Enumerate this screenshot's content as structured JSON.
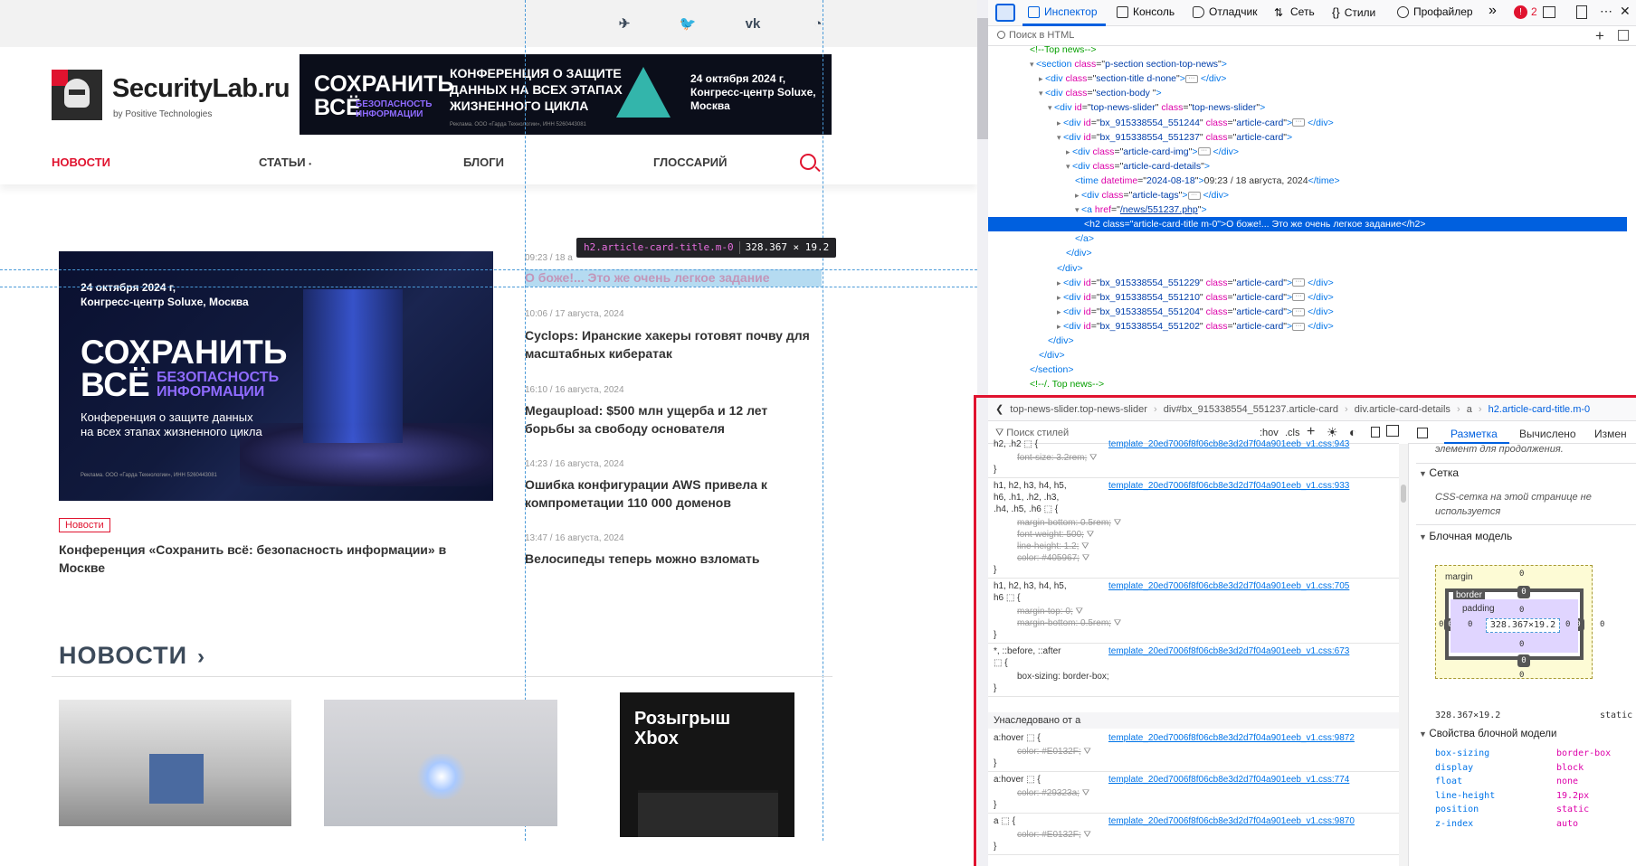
{
  "site": {
    "social_icons": [
      "telegram-icon",
      "twitter-icon",
      "vk-icon",
      "rss-icon"
    ],
    "social_glyphs": [
      "✈",
      "🐦",
      "vk",
      "◔"
    ],
    "logo": {
      "title": "SecurityLab.ru",
      "subtitle": "by Positive Technologies"
    },
    "top_banner": {
      "big": "СОХРАНИТЬ\nВСЁ",
      "sub": "БЕЗОПАСНОСТЬ\nИНФОРМАЦИИ",
      "headline": "КОНФЕРЕНЦИЯ О ЗАЩИТЕ ДАННЫХ НА ВСЕХ ЭТАПАХ ЖИЗНЕННОГО ЦИКЛА",
      "date": "24 октября 2024 г, Конгресс-центр Soluxe, Москва",
      "fine": "Реклама. ООО «Гарда Технологии», ИНН 5260443081"
    },
    "nav": {
      "news": "НОВОСТИ",
      "articles": "СТАТЬИ",
      "articles_dot": "•",
      "blogs": "БЛОГИ",
      "glossary": "ГЛОССАРИЙ"
    },
    "hero": {
      "date": "24 октября 2024 г,\nКонгресс-центр Soluxe, Москва",
      "big": "СОХРАНИТЬ\nВСЁ",
      "purple": "БЕЗОПАСНОСТЬ\nИНФОРМАЦИИ",
      "text": "Конференция о защите данных\nна всех этапах жизненного цикла",
      "fine": "Реклама. ООО «Гарда Технологии», ИНН 5260443081",
      "tag": "Новости",
      "title": "Конференция «Сохранить всё: безопасность информации» в Москве"
    },
    "news": [
      {
        "date": "09:23 / 18 а",
        "title": "О боже!... Это же очень легкое задание"
      },
      {
        "date": "10:06 / 17 августа, 2024",
        "title": "Cyclops: Иранские хакеры готовят почву для масштабных кибератак"
      },
      {
        "date": "16:10 / 16 августа, 2024",
        "title": "Megaupload: $500 млн ущерба и 12 лет борьбы за свободу основателя"
      },
      {
        "date": "14:23 / 16 августа, 2024",
        "title": "Ошибка конфигурации AWS привела к компрометации 110 000 доменов"
      },
      {
        "date": "13:47 / 16 августа, 2024",
        "title": "Велосипеды теперь можно взломать"
      }
    ],
    "tooltip": {
      "selector": "h2.article-card-title.m-0",
      "size": "328.367 × 19.2"
    },
    "section": {
      "title": "НОВОСТИ",
      "arrow": "›"
    },
    "card3_title": "Розыгрыш\nXbox"
  },
  "devtools": {
    "tabs": {
      "inspector": "Инспектор",
      "console": "Консоль",
      "debugger": "Отладчик",
      "network": "Сеть",
      "styles": "Стили",
      "profiler": "Профайлер",
      "more": "»",
      "errors": "2"
    },
    "html_search_placeholder": "Поиск в HTML",
    "tree": [
      {
        "ind": 4,
        "type": "comment",
        "text": "<!--Top news-->"
      },
      {
        "ind": 4,
        "arrow": "▾",
        "tag": "section",
        "attrs": [
          [
            "class",
            "p-section section-top-news"
          ]
        ],
        "close": false
      },
      {
        "ind": 5,
        "arrow": "▸",
        "tag": "div",
        "attrs": [
          [
            "class",
            "section-title d-none"
          ]
        ],
        "ellipsis": true,
        "close": true
      },
      {
        "ind": 5,
        "arrow": "▾",
        "tag": "div",
        "attrs": [
          [
            "class",
            "section-body "
          ]
        ],
        "close": false
      },
      {
        "ind": 6,
        "arrow": "▾",
        "tag": "div",
        "attrs": [
          [
            "id",
            "top-news-slider"
          ],
          [
            "class",
            "top-news-slider"
          ]
        ],
        "close": false
      },
      {
        "ind": 7,
        "arrow": "▸",
        "tag": "div",
        "attrs": [
          [
            "id",
            "bx_915338554_551244"
          ],
          [
            "class",
            "article-card"
          ]
        ],
        "ellipsis": true,
        "close": true
      },
      {
        "ind": 7,
        "arrow": "▾",
        "tag": "div",
        "attrs": [
          [
            "id",
            "bx_915338554_551237"
          ],
          [
            "class",
            "article-card"
          ]
        ],
        "close": false
      },
      {
        "ind": 8,
        "arrow": "▸",
        "tag": "div",
        "attrs": [
          [
            "class",
            "article-card-img"
          ]
        ],
        "ellipsis": true,
        "close": true
      },
      {
        "ind": 8,
        "arrow": "▾",
        "tag": "div",
        "attrs": [
          [
            "class",
            "article-card-details"
          ]
        ],
        "close": false
      },
      {
        "ind": 9,
        "tag": "time",
        "attrs": [
          [
            "datetime",
            "2024-08-18"
          ]
        ],
        "inner": "09:23 / 18 августа, 2024",
        "close": true
      },
      {
        "ind": 9,
        "arrow": "▸",
        "tag": "div",
        "attrs": [
          [
            "class",
            "article-tags"
          ]
        ],
        "ellipsis": true,
        "close": true
      },
      {
        "ind": 9,
        "arrow": "▾",
        "tag": "a",
        "attrs": [
          [
            "href",
            "/news/551237.php"
          ]
        ],
        "close": false
      },
      {
        "ind": 10,
        "tag": "h2",
        "attrs": [
          [
            "class",
            "article-card-title m-0"
          ]
        ],
        "inner": "О боже!... Это же очень легкое задание",
        "close": true,
        "selected": true
      },
      {
        "ind": 9,
        "type": "closetag",
        "text": "</a>"
      },
      {
        "ind": 8,
        "type": "closetag",
        "text": "</div>"
      },
      {
        "ind": 7,
        "type": "closetag",
        "text": "</div>"
      },
      {
        "ind": 7,
        "arrow": "▸",
        "tag": "div",
        "attrs": [
          [
            "id",
            "bx_915338554_551229"
          ],
          [
            "class",
            "article-card"
          ]
        ],
        "ellipsis": true,
        "close": true
      },
      {
        "ind": 7,
        "arrow": "▸",
        "tag": "div",
        "attrs": [
          [
            "id",
            "bx_915338554_551210"
          ],
          [
            "class",
            "article-card"
          ]
        ],
        "ellipsis": true,
        "close": true
      },
      {
        "ind": 7,
        "arrow": "▸",
        "tag": "div",
        "attrs": [
          [
            "id",
            "bx_915338554_551204"
          ],
          [
            "class",
            "article-card"
          ]
        ],
        "ellipsis": true,
        "close": true
      },
      {
        "ind": 7,
        "arrow": "▸",
        "tag": "div",
        "attrs": [
          [
            "id",
            "bx_915338554_551202"
          ],
          [
            "class",
            "article-card"
          ]
        ],
        "ellipsis": true,
        "close": true
      },
      {
        "ind": 6,
        "type": "closetag",
        "text": "</div>"
      },
      {
        "ind": 5,
        "type": "closetag",
        "text": "</div>"
      },
      {
        "ind": 4,
        "type": "closetag",
        "text": "</section>"
      },
      {
        "ind": 4,
        "type": "comment",
        "text": "<!--/. Top news-->"
      }
    ],
    "breadcrumb": [
      "top-news-slider.top-news-slider",
      "div#bx_915338554_551237.article-card",
      "div.article-card-details",
      "a",
      "h2.article-card-title.m-0"
    ],
    "rules_toolbar": {
      "filter": "Поиск стилей",
      "hov": ":hov",
      "cls": ".cls",
      "plus": "+"
    },
    "rules": [
      {
        "sel": "h2, .h2 ⬚ {",
        "src": "template_20ed7006f8f06cb8e3d2d7f04a901eeb_v1.css:943",
        "props": [
          [
            "font-size",
            "3.2rem",
            true
          ]
        ]
      },
      {
        "sel": "h1, h2, h3, h4, h5,\nh6, .h1, .h2, .h3,\n.h4, .h5, .h6 ⬚ {",
        "src": "template_20ed7006f8f06cb8e3d2d7f04a901eeb_v1.css:933",
        "props": [
          [
            "margin-bottom",
            "0.5rem",
            true
          ],
          [
            "font-weight",
            "500",
            true
          ],
          [
            "line-height",
            "1.2",
            true
          ],
          [
            "color",
            "#405967",
            true
          ]
        ]
      },
      {
        "sel": "h1, h2, h3, h4, h5,\nh6 ⬚ {",
        "src": "template_20ed7006f8f06cb8e3d2d7f04a901eeb_v1.css:705",
        "props": [
          [
            "margin-top",
            "0",
            true
          ],
          [
            "margin-bottom",
            "0.5rem",
            true
          ]
        ]
      },
      {
        "sel": "*, ::before, ::after\n⬚ {",
        "src": "template_20ed7006f8f06cb8e3d2d7f04a901eeb_v1.css:673",
        "props": [
          [
            "box-sizing",
            "border-box",
            false
          ]
        ]
      }
    ],
    "inherited_label": "Унаследовано от a",
    "inherited_rules": [
      {
        "sel": "a:hover ⬚ {",
        "src": "template_20ed7006f8f06cb8e3d2d7f04a901eeb_v1.css:9872",
        "props": [
          [
            "color",
            "#E0132F",
            true
          ]
        ]
      },
      {
        "sel": "a:hover ⬚ {",
        "src": "template_20ed7006f8f06cb8e3d2d7f04a901eeb_v1.css:774",
        "props": [
          [
            "color",
            "#29323a",
            true
          ]
        ]
      },
      {
        "sel": "a ⬚ {",
        "src": "template_20ed7006f8f06cb8e3d2d7f04a901eeb_v1.css:9870",
        "props": [
          [
            "color",
            "#E0132F",
            true
          ]
        ]
      }
    ],
    "layout": {
      "tabs": [
        "Разметка",
        "Вычислено",
        "Измен"
      ],
      "flex_note": "элемент для продолжения.",
      "grid_head": "Сетка",
      "grid_note": "CSS-сетка на этой странице не используется",
      "box_head": "Блочная модель",
      "margin_label": "margin",
      "border_label": "border",
      "padding_label": "padding",
      "content": "328.367×19.2",
      "zero": "0",
      "dims": "328.367×19.2",
      "position": "static",
      "props_head": "Свойства блочной модели",
      "props": [
        [
          "box-sizing",
          "border-box"
        ],
        [
          "display",
          "block"
        ],
        [
          "float",
          "none"
        ],
        [
          "line-height",
          "19.2px"
        ],
        [
          "position",
          "static"
        ],
        [
          "z-index",
          "auto"
        ]
      ]
    }
  },
  "colors": {
    "brand_red": "#E0132F",
    "selection_blue": "#0060DF",
    "guide_blue": "#4A9AD8"
  }
}
